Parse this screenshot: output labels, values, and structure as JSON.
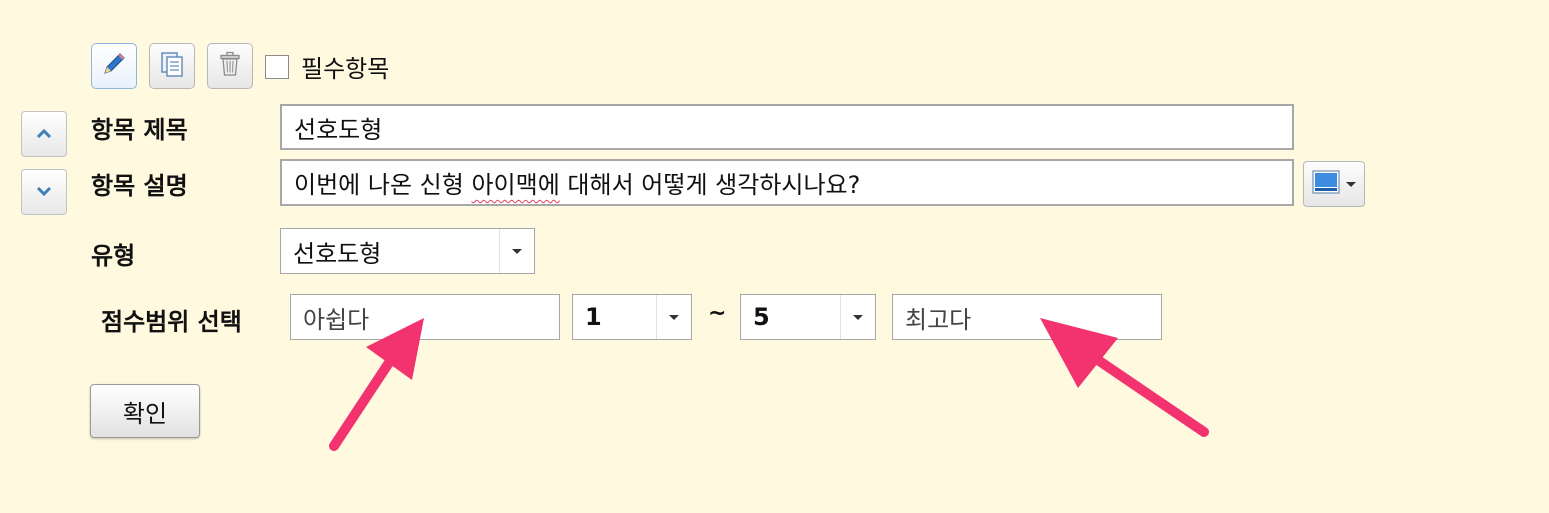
{
  "toolbar": {
    "edit_icon": "pencil-icon",
    "copy_icon": "copy-document-icon",
    "delete_icon": "trash-icon",
    "required_label": "필수항목",
    "required_checked": false
  },
  "reorder": {
    "up_icon": "chevron-up-icon",
    "down_icon": "chevron-down-icon"
  },
  "form": {
    "title_label": "항목 제목",
    "title_value": "선호도형",
    "desc_label": "항목 설명",
    "desc_value_pre": "이번에 나온 신형 ",
    "desc_value_misspelled": "아이맥에",
    "desc_value_post": " 대해서 어떻게 생각하시나요?",
    "desc_color_icon": "color-picker-icon",
    "type_label": "유형",
    "type_value": "선호도형",
    "range_label": "점수범위 선택",
    "range_min_placeholder": "아쉽다",
    "range_min_value": "1",
    "range_separator": "~",
    "range_max_value": "5",
    "range_max_placeholder": "최고다",
    "confirm_label": "확인"
  },
  "colors": {
    "background": "#fffadf",
    "annotation_arrow": "#f2336f",
    "active_border": "#8fb6de",
    "up_down_icon": "#3f7fb8"
  }
}
